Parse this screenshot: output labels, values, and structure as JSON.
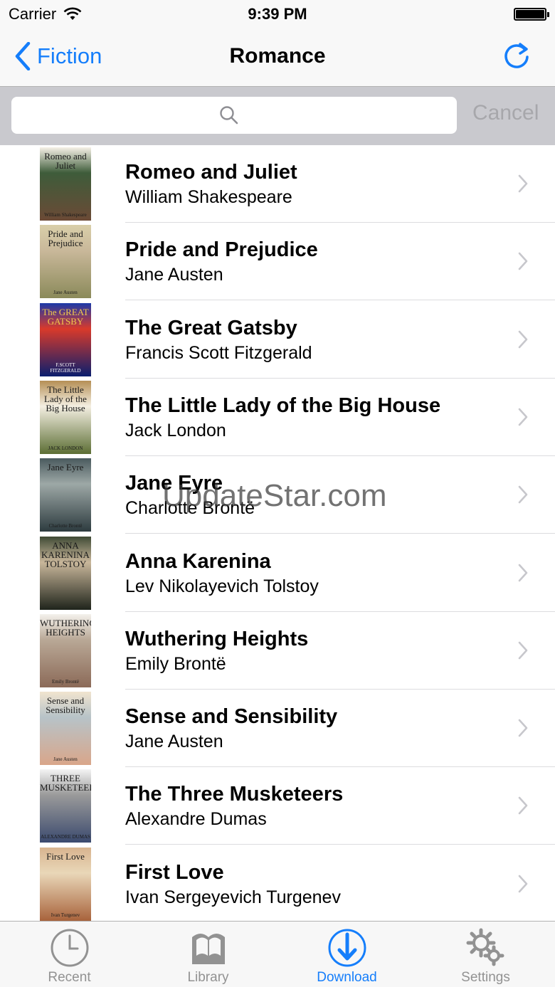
{
  "status_bar": {
    "carrier": "Carrier",
    "time": "9:39 PM"
  },
  "nav": {
    "back_label": "Fiction",
    "title": "Romance"
  },
  "search": {
    "placeholder": "",
    "cancel_label": "Cancel"
  },
  "books": [
    {
      "title": "Romeo and Juliet",
      "author": "William Shakespeare",
      "cover_title": "Romeo and Juliet",
      "cover_author": "William Shakespeare",
      "cover_colors": [
        "#f6f1e7",
        "#6b4a36",
        "#3e5c3a"
      ]
    },
    {
      "title": "Pride and Prejudice",
      "author": "Jane Austen",
      "cover_title": "Pride and Prejudice",
      "cover_author": "Jane Austen",
      "cover_colors": [
        "#d9cfa9",
        "#8b8a5a",
        "#c9b89a"
      ]
    },
    {
      "title": "The Great Gatsby",
      "author": "Francis Scott Fitzgerald",
      "cover_title": "The GREAT GATSBY",
      "cover_author": "F.SCOTT FITZGERALD",
      "cover_colors": [
        "#1c3aa8",
        "#0a1e6e",
        "#d93a2a"
      ]
    },
    {
      "title": "The Little Lady of the Big House",
      "author": "Jack London",
      "cover_title": "The Little Lady of the Big House",
      "cover_author": "JACK LONDON",
      "cover_colors": [
        "#b58f55",
        "#5c6e34",
        "#f4efe2"
      ]
    },
    {
      "title": "Jane Eyre",
      "author": "Charlotte Brontë",
      "cover_title": "Jane Eyre",
      "cover_author": "Charlotte Brontë",
      "cover_colors": [
        "#4a5a5e",
        "#2d3b3f",
        "#9da8a6"
      ]
    },
    {
      "title": "Anna Karenina",
      "author": "Lev Nikolayevich Tolstoy",
      "cover_title": "ANNA KARENINA TOLSTOY",
      "cover_author": "",
      "cover_colors": [
        "#3f4a35",
        "#1f241b",
        "#c9b79b"
      ]
    },
    {
      "title": "Wuthering Heights",
      "author": "Emily Brontë",
      "cover_title": "WUTHERING HEIGHTS",
      "cover_author": "Emily Brontë",
      "cover_colors": [
        "#f4f1ec",
        "#8b6a58",
        "#b9a896"
      ]
    },
    {
      "title": "Sense and Sensibility",
      "author": "Jane Austen",
      "cover_title": "Sense and Sensibility",
      "cover_author": "Jane Austen",
      "cover_colors": [
        "#f1e4cf",
        "#d9a68a",
        "#b7c3c8"
      ]
    },
    {
      "title": "The Three Musketeers",
      "author": "Alexandre Dumas",
      "cover_title": "THREE MUSKETEERS",
      "cover_author": "ALEXANDRE DUMAS",
      "cover_colors": [
        "#f4f4f4",
        "#3b4a6e",
        "#9a9a9a"
      ]
    },
    {
      "title": "First Love",
      "author": "Ivan Sergeyevich Turgenev",
      "cover_title": "First Love",
      "cover_author": "Ivan Turgenev",
      "cover_colors": [
        "#d8b48f",
        "#a8633c",
        "#e9d7b8"
      ]
    }
  ],
  "watermark": "UpdateStar.com",
  "tabs": [
    {
      "label": "Recent",
      "icon": "clock-icon"
    },
    {
      "label": "Library",
      "icon": "book-icon"
    },
    {
      "label": "Download",
      "icon": "download-icon",
      "active": true
    },
    {
      "label": "Settings",
      "icon": "gear-icon"
    }
  ],
  "colors": {
    "accent": "#157efb",
    "inactive": "#929292"
  }
}
